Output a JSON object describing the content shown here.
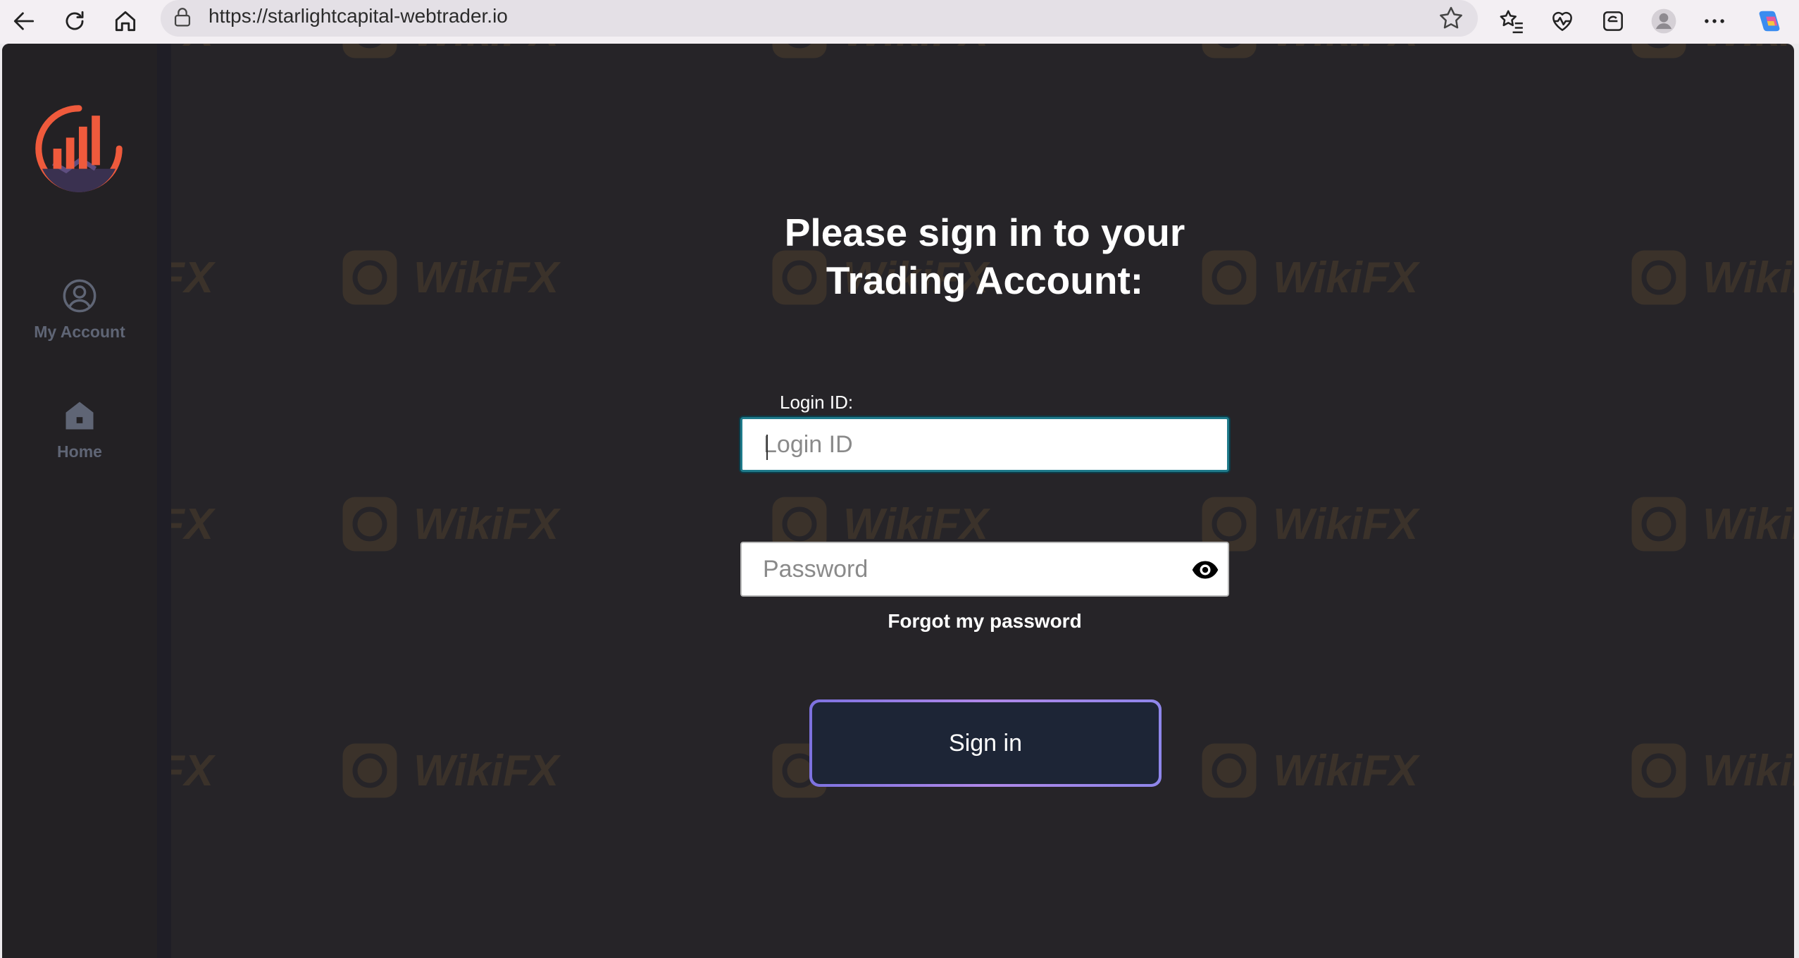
{
  "browser": {
    "url": "https://starlightcapital-webtrader.io"
  },
  "sidebar": {
    "items": [
      {
        "label": "My Account",
        "icon": "user-circle-icon"
      },
      {
        "label": "Home",
        "icon": "home-icon"
      }
    ]
  },
  "watermark": {
    "text": "WikiFX"
  },
  "form": {
    "heading_line1": "Please sign in to your",
    "heading_line2": "Trading Account:",
    "login_label": "Login ID:",
    "login_placeholder": "Login ID",
    "password_placeholder": "Password",
    "forgot_label": "Forgot my password",
    "signin_label": "Sign in"
  },
  "colors": {
    "background": "#262428",
    "sidebar": "#232124",
    "logo_accent": "#ef5a3c",
    "button_bg": "#1d2536",
    "button_border": "#8e7ee6"
  }
}
